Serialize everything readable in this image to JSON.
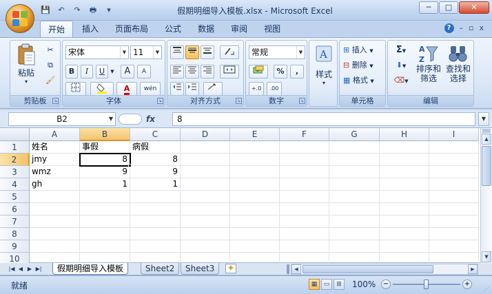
{
  "window": {
    "title": "假期明细导入模板.xlsx - Microsoft Excel",
    "minimize_glyph": "─",
    "maximize_glyph": "□",
    "close_glyph": "✕"
  },
  "qat": {
    "save": "💾",
    "undo": "↶",
    "redo": "↷",
    "print": "🖶",
    "more": "▾"
  },
  "tabs": [
    "开始",
    "插入",
    "页面布局",
    "公式",
    "数据",
    "审阅",
    "视图"
  ],
  "tab_tools": {
    "help": "?",
    "min": "–",
    "restore": "▫",
    "close": "x"
  },
  "ribbon": {
    "clipboard": {
      "label": "剪贴板",
      "paste": "粘贴"
    },
    "font": {
      "label": "字体",
      "name": "宋体",
      "size": "11",
      "bold": "B",
      "italic": "I",
      "underline": "U",
      "grow": "A",
      "shrink": "A",
      "phonetic": "wén",
      "font_color_glyph": "A"
    },
    "alignment": {
      "label": "对齐方式"
    },
    "number": {
      "label": "数字",
      "format": "常规",
      "percent": "%",
      "comma": ",",
      "inc_dec": "+.0",
      "dec_dec": ".00"
    },
    "styles": {
      "label": "样式"
    },
    "cells": {
      "label": "单元格",
      "insert": "插入",
      "delete": "删除",
      "format": "格式"
    },
    "editing": {
      "label": "编辑",
      "sum": "Σ",
      "sort_filter": "排序和\n筛选",
      "find_select": "查找和\n选择"
    }
  },
  "formula_bar": {
    "name_box": "B2",
    "fx": "fx",
    "value": "8"
  },
  "grid": {
    "columns": [
      "A",
      "B",
      "C",
      "D",
      "E",
      "F",
      "G",
      "H",
      "I"
    ],
    "rows": [
      "1",
      "2",
      "3",
      "4",
      "5",
      "6",
      "7",
      "8",
      "9",
      "10"
    ],
    "cells": [
      [
        "姓名",
        "事假",
        "病假"
      ],
      [
        "jmy",
        "8",
        "8"
      ],
      [
        "wmz",
        "9",
        "9"
      ],
      [
        "gh",
        "1",
        "1"
      ]
    ],
    "selected": "B2"
  },
  "sheets": {
    "tabs": [
      "假期明细导入模板",
      "Sheet2",
      "Sheet3"
    ],
    "active": 0
  },
  "status": {
    "mode": "就绪",
    "zoom": "100%",
    "zoom_fraction": 0.5
  },
  "colors": {
    "accent": "#f6c15a",
    "ribbon": "#dde8f7",
    "title": "#c5d8f1"
  }
}
